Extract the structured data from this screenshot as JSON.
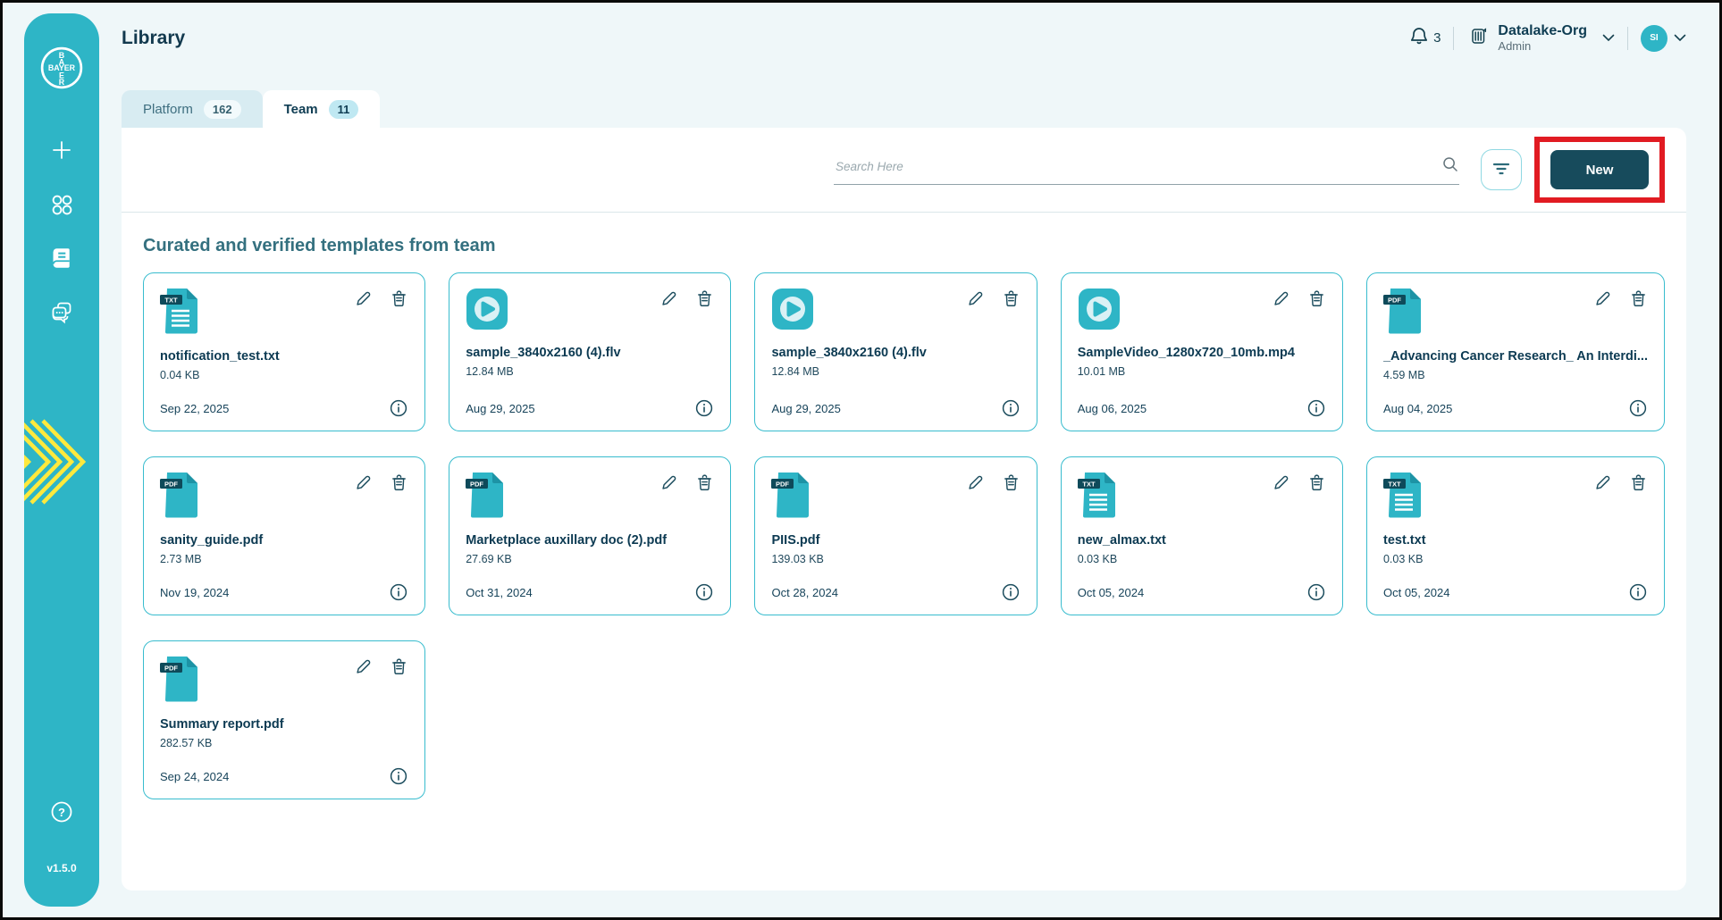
{
  "header": {
    "title": "Library",
    "notifications": {
      "count": "3"
    },
    "org": {
      "name": "Datalake-Org",
      "role": "Admin"
    },
    "user": {
      "initials": "SI"
    }
  },
  "sidebar": {
    "logo": "bayer-cross-logo",
    "items": [
      {
        "icon": "plus-icon"
      },
      {
        "icon": "apps-grid-icon"
      },
      {
        "icon": "library-book-icon",
        "active": true
      },
      {
        "icon": "chat-icon"
      }
    ],
    "help_icon": "help-icon",
    "version": "v1.5.0"
  },
  "tabs": [
    {
      "label": "Platform",
      "count": "162",
      "active": false
    },
    {
      "label": "Team",
      "count": "11",
      "active": true
    }
  ],
  "toolbar": {
    "search_placeholder": "Search Here",
    "new_button_label": "New"
  },
  "section_title": "Curated and verified templates from team",
  "cards": [
    {
      "name": "notification_test.txt",
      "size": "0.04 KB",
      "date": "Sep 22, 2025",
      "type": "txt",
      "badge": "TXT"
    },
    {
      "name": "sample_3840x2160 (4).flv",
      "size": "12.84 MB",
      "date": "Aug 29, 2025",
      "type": "video",
      "badge": ""
    },
    {
      "name": "sample_3840x2160 (4).flv",
      "size": "12.84 MB",
      "date": "Aug 29, 2025",
      "type": "video",
      "badge": ""
    },
    {
      "name": "SampleVideo_1280x720_10mb.mp4",
      "size": "10.01 MB",
      "date": "Aug 06, 2025",
      "type": "video",
      "badge": ""
    },
    {
      "name": "_Advancing Cancer Research_ An Interdi...",
      "size": "4.59 MB",
      "date": "Aug 04, 2025",
      "type": "pdf",
      "badge": "PDF"
    },
    {
      "name": "sanity_guide.pdf",
      "size": "2.73 MB",
      "date": "Nov 19, 2024",
      "type": "pdf",
      "badge": "PDF"
    },
    {
      "name": "Marketplace auxillary doc (2).pdf",
      "size": "27.69 KB",
      "date": "Oct 31, 2024",
      "type": "pdf",
      "badge": "PDF"
    },
    {
      "name": "PIIS.pdf",
      "size": "139.03 KB",
      "date": "Oct 28, 2024",
      "type": "pdf",
      "badge": "PDF"
    },
    {
      "name": "new_almax.txt",
      "size": "0.03 KB",
      "date": "Oct 05, 2024",
      "type": "txt",
      "badge": "TXT"
    },
    {
      "name": "test.txt",
      "size": "0.03 KB",
      "date": "Oct 05, 2024",
      "type": "txt",
      "badge": "TXT"
    },
    {
      "name": "Summary report.pdf",
      "size": "282.57 KB",
      "date": "Sep 24, 2024",
      "type": "pdf",
      "badge": "PDF"
    }
  ],
  "colors": {
    "accent_teal": "#2eb5c6",
    "dark_teal": "#174b5c",
    "card_border": "#38bcce",
    "highlight_red": "#e11b22",
    "decoration_yellow": "#ffe93d"
  }
}
